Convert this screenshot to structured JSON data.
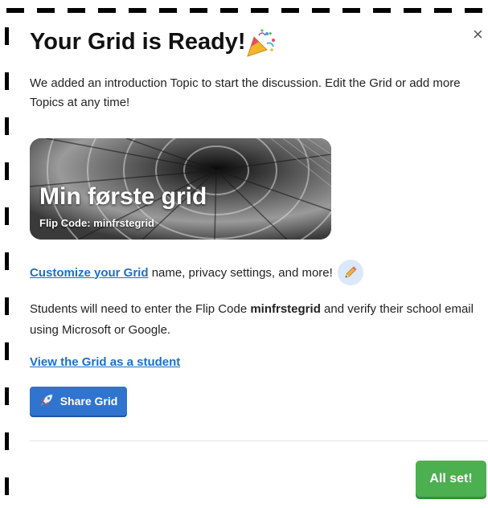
{
  "dialog": {
    "close_symbol": "×",
    "title": "Your Grid is Ready!",
    "title_emoji_icon": "party-popper-icon",
    "intro": "We added an introduction Topic to start the discussion. Edit the Grid or add more Topics at any time!"
  },
  "banner": {
    "grid_name": "Min første grid",
    "flip_code_line": "Flip Code: minfrstegrid",
    "image": "spiral-staircase-photo"
  },
  "customize": {
    "link_text": "Customize your Grid",
    "trailing_text": " name, privacy settings, and more!",
    "icon": "pencil-icon"
  },
  "students": {
    "before": "Students will need to enter the Flip Code ",
    "code": "minfrstegrid",
    "after": " and verify their school email using Microsoft or Google."
  },
  "view_link": "View the Grid as a student",
  "share_button": {
    "label": "Share Grid",
    "icon": "rocket-icon"
  },
  "allset_button": {
    "label": "All set!"
  },
  "colors": {
    "link": "#1f6fc4",
    "share_button": "#2f74cf",
    "allset_button": "#4caf50"
  }
}
